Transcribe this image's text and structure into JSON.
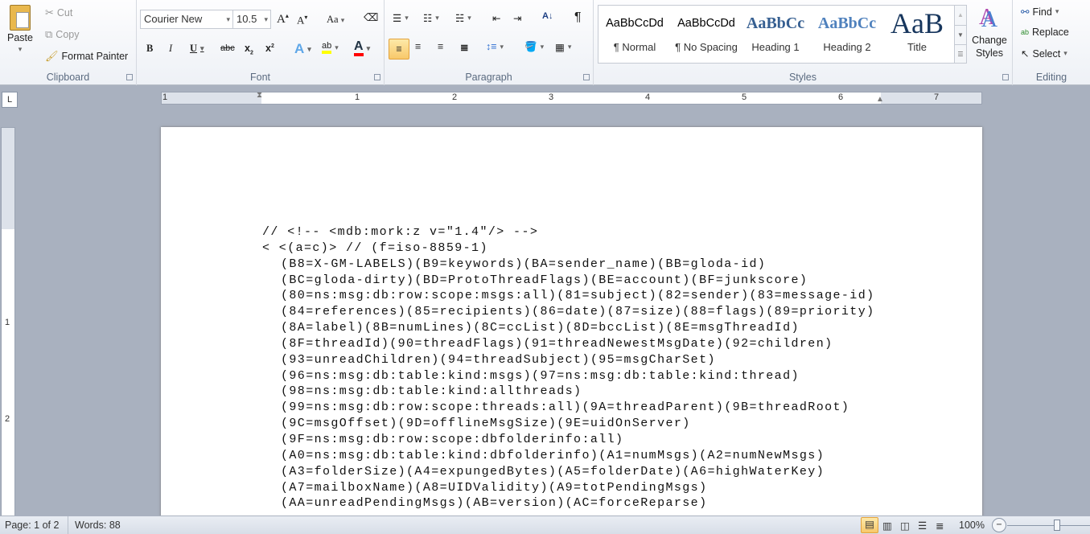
{
  "clipboard": {
    "paste": "Paste",
    "cut": "Cut",
    "copy": "Copy",
    "format_painter": "Format Painter",
    "label": "Clipboard"
  },
  "font": {
    "name": "Courier New",
    "size": "10.5",
    "label": "Font",
    "highlight_color": "#ffff00",
    "font_color": "#ff0000"
  },
  "paragraph": {
    "label": "Paragraph"
  },
  "styles": {
    "label": "Styles",
    "items": [
      {
        "preview": "AaBbCcDd",
        "name": "¶ Normal"
      },
      {
        "preview": "AaBbCcDd",
        "name": "¶ No Spacing"
      },
      {
        "preview": "AaBbCc",
        "name": "Heading 1"
      },
      {
        "preview": "AaBbCc",
        "name": "Heading 2"
      },
      {
        "preview": "AaB",
        "name": "Title"
      }
    ],
    "change_styles": "Change Styles"
  },
  "editing": {
    "label": "Editing",
    "find": "Find",
    "replace": "Replace",
    "select": "Select"
  },
  "ruler": {
    "numbers": [
      "1",
      "1",
      "2",
      "3",
      "4",
      "5",
      "6",
      "7"
    ],
    "vnumbers": [
      "1",
      "2"
    ],
    "tab_selector": "L"
  },
  "document": {
    "lines": [
      "// <!-- <mdb:mork:z v=\"1.4\"/> -->",
      "< <(a=c)> // (f=iso-8859-1)",
      "(B8=X-GM-LABELS)(B9=keywords)(BA=sender_name)(BB=gloda-id)",
      "(BC=gloda-dirty)(BD=ProtoThreadFlags)(BE=account)(BF=junkscore)",
      "(80=ns:msg:db:row:scope:msgs:all)(81=subject)(82=sender)(83=message-id)",
      "(84=references)(85=recipients)(86=date)(87=size)(88=flags)(89=priority)",
      "(8A=label)(8B=numLines)(8C=ccList)(8D=bccList)(8E=msgThreadId)",
      "(8F=threadId)(90=threadFlags)(91=threadNewestMsgDate)(92=children)",
      "(93=unreadChildren)(94=threadSubject)(95=msgCharSet)",
      "(96=ns:msg:db:table:kind:msgs)(97=ns:msg:db:table:kind:thread)",
      "(98=ns:msg:db:table:kind:allthreads)",
      "(99=ns:msg:db:row:scope:threads:all)(9A=threadParent)(9B=threadRoot)",
      "(9C=msgOffset)(9D=offlineMsgSize)(9E=uidOnServer)",
      "(9F=ns:msg:db:row:scope:dbfolderinfo:all)",
      "(A0=ns:msg:db:table:kind:dbfolderinfo)(A1=numMsgs)(A2=numNewMsgs)",
      "(A3=folderSize)(A4=expungedBytes)(A5=folderDate)(A6=highWaterKey)",
      "(A7=mailboxName)(A8=UIDValidity)(A9=totPendingMsgs)",
      "(AA=unreadPendingMsgs)(AB=version)(AC=forceReparse)"
    ]
  },
  "status": {
    "page": "Page: 1 of 2",
    "words": "Words: 88",
    "zoom": "100%",
    "zoom_percent": 100
  }
}
